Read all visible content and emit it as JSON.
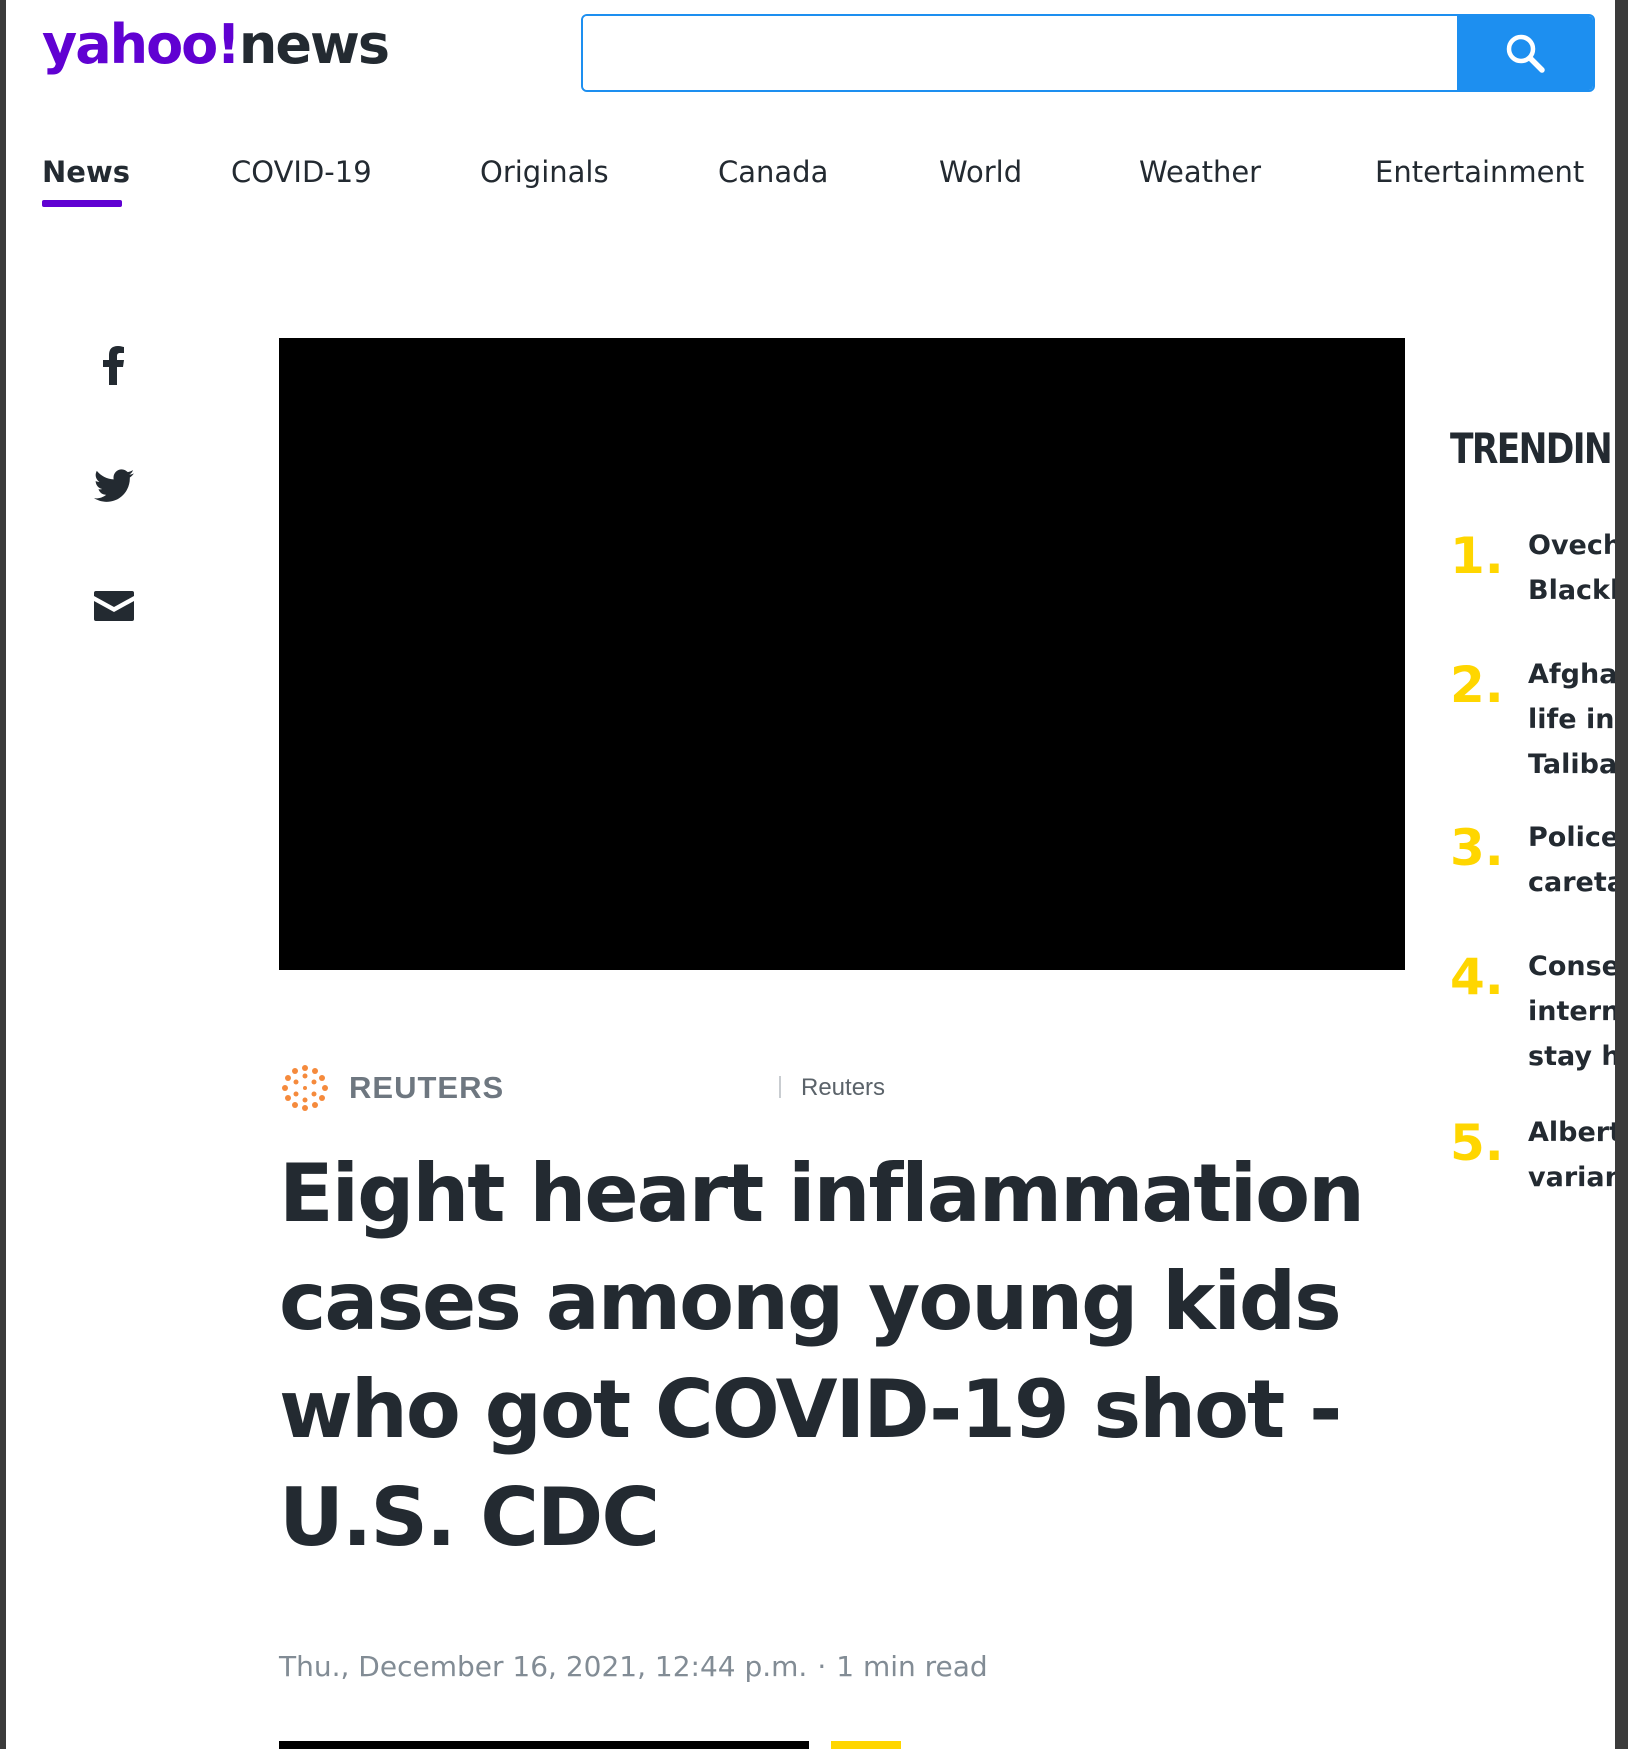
{
  "header": {
    "logo_primary": "yahoo!",
    "logo_secondary": "news",
    "search": {
      "value": "",
      "placeholder": ""
    }
  },
  "nav": {
    "items": [
      {
        "label": "News",
        "active": true
      },
      {
        "label": "COVID-19"
      },
      {
        "label": "Originals"
      },
      {
        "label": "Canada"
      },
      {
        "label": "World"
      },
      {
        "label": "Weather"
      },
      {
        "label": "Entertainment"
      }
    ]
  },
  "share": {
    "icons": [
      "facebook-icon",
      "twitter-icon",
      "mail-icon"
    ]
  },
  "article": {
    "source_logo_text": "REUTERS",
    "author": "Reuters",
    "headline": "Eight heart inflammation cases among young kids who got COVID-19 shot - U.S. CDC",
    "date": "Thu., December 16, 2021, 12:44 p.m.",
    "separator": "·",
    "read_time": "1 min read"
  },
  "trending": {
    "title": "TRENDIN",
    "items": [
      {
        "num": "1.",
        "lines": [
          "Ovech",
          "Blackh"
        ]
      },
      {
        "num": "2.",
        "lines": [
          "Afgha",
          "life in",
          "Taliba"
        ]
      },
      {
        "num": "3.",
        "lines": [
          "Police",
          "careta"
        ]
      },
      {
        "num": "4.",
        "lines": [
          "Conse",
          "intern",
          "stay h"
        ]
      },
      {
        "num": "5.",
        "lines": [
          "Albert",
          "varian"
        ]
      }
    ]
  },
  "colors": {
    "brand_purple": "#6001d2",
    "search_blue": "#1d8ff0",
    "trending_yellow": "#ffd600",
    "text_dark": "#232a31",
    "meta_gray": "#828c95"
  }
}
